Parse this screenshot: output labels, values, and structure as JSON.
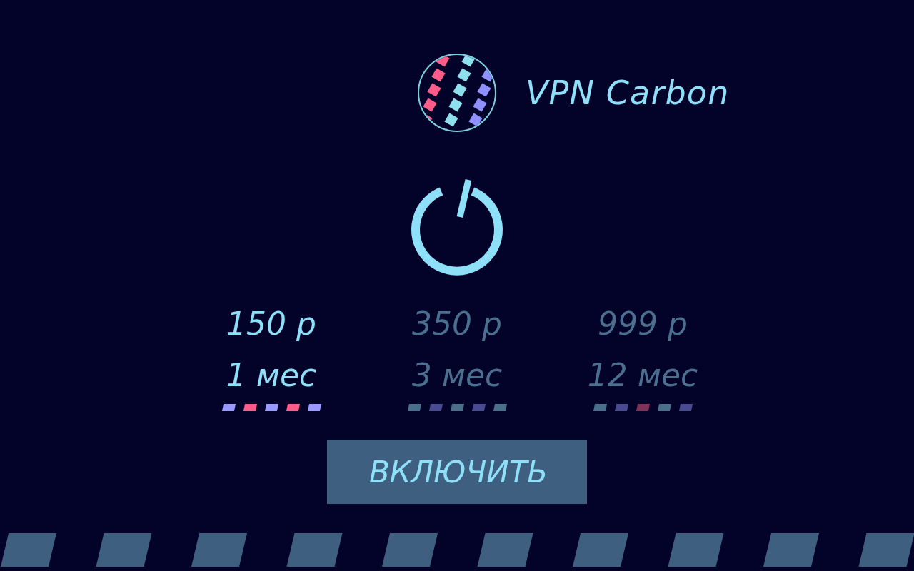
{
  "app": {
    "title": "VPN Carbon"
  },
  "plans": [
    {
      "price": "150 р",
      "period": "1 мес",
      "selected": true,
      "dashes": [
        {
          "color": "#9999ff"
        },
        {
          "color": "#ff5c8a"
        },
        {
          "color": "#9999ff"
        },
        {
          "color": "#ff5c8a"
        },
        {
          "color": "#9999ff"
        }
      ]
    },
    {
      "price": "350 р",
      "period": "3 мес",
      "selected": false,
      "dashes": [
        {
          "color": "#4a6f8a"
        },
        {
          "color": "#4a4a90"
        },
        {
          "color": "#4a6f8a"
        },
        {
          "color": "#4a4a90"
        },
        {
          "color": "#4a6f8a"
        }
      ]
    },
    {
      "price": "999 р",
      "period": "12 мес",
      "selected": false,
      "dashes": [
        {
          "color": "#4a6f8a"
        },
        {
          "color": "#4a4a90"
        },
        {
          "color": "#803358"
        },
        {
          "color": "#4a6f8a"
        },
        {
          "color": "#4a4a90"
        }
      ]
    }
  ],
  "action_button": {
    "label": "ВКЛЮЧИТЬ"
  }
}
